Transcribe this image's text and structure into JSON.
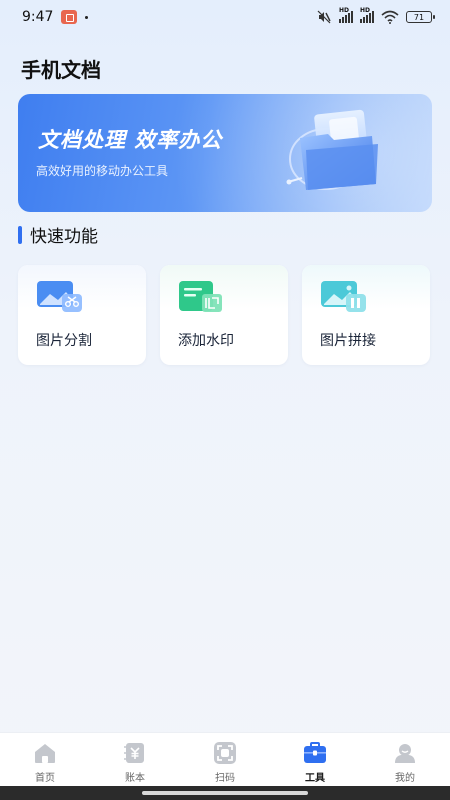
{
  "status_bar": {
    "time": "9:47",
    "battery": "71"
  },
  "header": {
    "title": "手机文档"
  },
  "banner": {
    "title": "文档处理 效率办公",
    "subtitle": "高效好用的移动办公工具"
  },
  "quick_functions": {
    "title": "快速功能",
    "items": [
      {
        "label": "图片分割",
        "icon": "image-split-icon"
      },
      {
        "label": "添加水印",
        "icon": "watermark-icon"
      },
      {
        "label": "图片拼接",
        "icon": "image-stitch-icon"
      }
    ]
  },
  "tab_bar": {
    "items": [
      {
        "label": "首页",
        "icon": "home-icon",
        "active": false
      },
      {
        "label": "账本",
        "icon": "ledger-icon",
        "active": false
      },
      {
        "label": "扫码",
        "icon": "scan-icon",
        "active": false
      },
      {
        "label": "工具",
        "icon": "toolbox-icon",
        "active": true
      },
      {
        "label": "我的",
        "icon": "profile-icon",
        "active": false
      }
    ]
  },
  "colors": {
    "accent": "#2f6ff0",
    "banner_start": "#3f7ef0",
    "banner_end": "#b7d2fb",
    "card_blue": "#4a8df2",
    "card_green": "#2fc88a",
    "card_cyan": "#4cc9d8"
  }
}
